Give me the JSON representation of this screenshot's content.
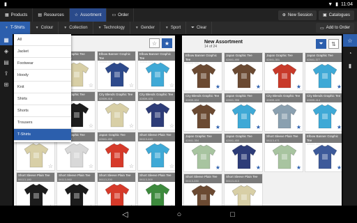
{
  "status": {
    "time": "11:04"
  },
  "topnav": {
    "tabs": [
      {
        "label": "Products"
      },
      {
        "label": "Resources"
      },
      {
        "label": "Assortment",
        "active": true
      },
      {
        "label": "Order"
      }
    ],
    "new_session": "New Session",
    "catalogues": "Catalogues"
  },
  "filters": {
    "tabs": [
      {
        "label": "T-Shirts",
        "active": true
      },
      {
        "label": "Colour"
      },
      {
        "label": "Collection"
      },
      {
        "label": "Technology"
      },
      {
        "label": "Gender"
      },
      {
        "label": "Sport"
      }
    ],
    "clear": "Clear",
    "add_to_order": "Add to Order"
  },
  "dropdown": {
    "items": [
      "All",
      "Jacket",
      "Footwear",
      "Hoody",
      "Knit",
      "Shirts",
      "Shorts",
      "Trousers",
      "T-Shirts"
    ],
    "selected": "T-Shirts"
  },
  "right_panel": {
    "title": "New Assortment",
    "subtitle": "14 of 24"
  },
  "left_tiles": [
    {
      "name": "",
      "sku": "",
      "color": "#6b7a48",
      "star": false
    },
    {
      "name": "Japan Graphic Tee",
      "sku": "42841-490",
      "color": "#d8cfa6",
      "star": false
    },
    {
      "name": "Elbow Banner Graphic Tee",
      "sku": "42833-392",
      "color": "#2d4a8c",
      "star": false
    },
    {
      "name": "Elbow Banner Graphic Tee",
      "sku": "42833-458",
      "color": "#3fa9d6",
      "star": false
    },
    {
      "name": "",
      "sku": "",
      "color": "#3f7fc4",
      "star": false
    },
    {
      "name": "Japan Graphic Tee",
      "sku": "42841-311",
      "color": "#1c1c1c",
      "star": false
    },
    {
      "name": "City Blends Graphic Tee",
      "sku": "42839-418",
      "color": "#d8cfa6",
      "star": false
    },
    {
      "name": "City Blends Graphic Tee",
      "sku": "42839-423",
      "color": "#2d3c78",
      "star": false
    },
    {
      "name": "",
      "sku": "",
      "color": "#d8cfa6",
      "star": false
    },
    {
      "name": "Japan Graphic Tee",
      "sku": "42841-490",
      "color": "#d8d8d8",
      "star": false
    },
    {
      "name": "Japan Graphic Tee",
      "sku": "42841-490",
      "color": "#d63a2a",
      "star": false
    },
    {
      "name": "Short Sleeve Plain Tee",
      "sku": "06113-440",
      "color": "#3fa9d6",
      "star": false
    },
    {
      "name": "Short Sleeve Plain Tee",
      "sku": "06113-180",
      "color": "#1c1c1c",
      "star": false
    },
    {
      "name": "Short Sleeve Plain Tee",
      "sku": "06113-060",
      "color": "#1c1c1c",
      "star": false
    },
    {
      "name": "Short Sleeve Plain Tee",
      "sku": "06113-200",
      "color": "#d63a2a",
      "star": false
    },
    {
      "name": "Short Sleeve Plain Tee",
      "sku": "06113-300",
      "color": "#3d8a3d",
      "star": false
    }
  ],
  "right_tiles": [
    {
      "name": "Elbow Banner Graphic Tee",
      "sku": "42833-390",
      "color": "#6b4a32",
      "star": true
    },
    {
      "name": "Japan Graphic Tee",
      "sku": "42841-490",
      "color": "#6b4a32",
      "star": true
    },
    {
      "name": "Japan Graphic Tee",
      "sku": "42841-301",
      "color": "#c83a2a",
      "star": true
    },
    {
      "name": "Japan Graphic Tee",
      "sku": "42841-377",
      "color": "#3fa9d6",
      "star": true
    },
    {
      "name": "City Blends Graphic Tee",
      "sku": "42839-404",
      "color": "#6b4a32",
      "star": true
    },
    {
      "name": "Japan Graphic Tee",
      "sku": "42841-356",
      "color": "#3fa9d6",
      "star": true
    },
    {
      "name": "City Blends Graphic Tee",
      "sku": "42839-420",
      "color": "#8aa0b0",
      "star": true
    },
    {
      "name": "City Blends Graphic Tee",
      "sku": "42839-414",
      "color": "#3fa9d6",
      "star": true
    },
    {
      "name": "Japan Graphic Tee",
      "sku": "42841-354",
      "color": "#a8c4a0",
      "star": true
    },
    {
      "name": "Japan Graphic Tee",
      "sku": "42841-450",
      "color": "#2d3c78",
      "star": true
    },
    {
      "name": "Short Sleeve Plain Tee",
      "sku": "06113-471",
      "color": "#a8c4a0",
      "star": true
    },
    {
      "name": "Elbow Banner Graphic Tee",
      "sku": "42833-391",
      "color": "#3d5a9a",
      "star": true
    },
    {
      "name": "Short Sleeve Plain Tee",
      "sku": "06113-330",
      "color": "#6b4a32",
      "star": false
    },
    {
      "name": "Short Sleeve Plain Tee",
      "sku": "06113-413",
      "color": "#d8cfa6",
      "star": false
    }
  ],
  "colors": {
    "accent": "#2c5fad"
  }
}
